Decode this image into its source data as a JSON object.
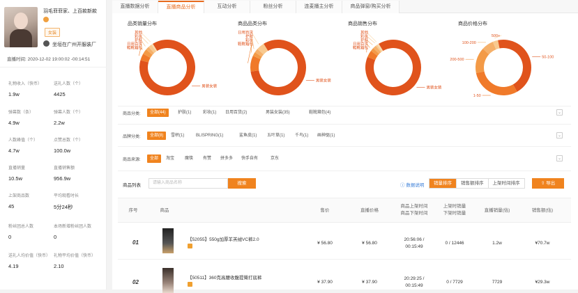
{
  "streamer": {
    "name": "羽毛菲菲家、上百款新款",
    "tag": "女装",
    "shop_name": "坐垣在广州开服装厂",
    "live_time_label": "直播时间:",
    "live_time": "2020-12-02 19:00:02 -00:14:51"
  },
  "stats": [
    {
      "label": "礼物收入（快币）",
      "value": "1.9w"
    },
    {
      "label": "送礼人数（个）",
      "value": "4425"
    },
    {
      "label": "弹幕数（条）",
      "value": "4.9w"
    },
    {
      "label": "弹幕人数（个）",
      "value": "2.2w"
    },
    {
      "label": "人数峰值（个）",
      "value": "4.7w"
    },
    {
      "label": "点赞总数（个）",
      "value": "100.0w"
    },
    {
      "label": "直播销量",
      "value": "10.5w"
    },
    {
      "label": "直播销售额",
      "value": "956.9w"
    },
    {
      "label": "上架商品数",
      "value": "45"
    },
    {
      "label": "平均观看时长",
      "value": "5分24秒"
    },
    {
      "label": "粉丝团总人数",
      "value": "0"
    },
    {
      "label": "本场新增粉丝团人数",
      "value": "0"
    },
    {
      "label": "送礼人均价值（快币）",
      "value": "4.19"
    },
    {
      "label": "礼物平均价值（快币）",
      "value": "2.10"
    }
  ],
  "tabs": [
    "直播数据分析",
    "直播商品分析",
    "互动分析",
    "粉丝分析",
    "连麦播主分析",
    "商品弹窗/购买分析"
  ],
  "active_tab": 1,
  "chart_data": [
    {
      "type": "pie",
      "title": "品类销量分布",
      "labels": [
        "男装女装",
        "鞋靴箱包",
        "日用百货",
        "护肤",
        "彩妆",
        "其他"
      ],
      "values": [
        88,
        4,
        3,
        2,
        2,
        1
      ]
    },
    {
      "type": "pie",
      "title": "商品品类分布",
      "labels": [
        "男装女装",
        "鞋靴箱包",
        "彩妆",
        "护肤",
        "日用百货"
      ],
      "values": [
        35,
        4,
        1,
        1,
        2
      ]
    },
    {
      "type": "pie",
      "title": "商品销售分布",
      "labels": [
        "男装女装",
        "鞋靴箱包",
        "日用百货",
        "护肤",
        "彩妆",
        "其他"
      ],
      "values": [
        90,
        4,
        2,
        2,
        1,
        1
      ]
    },
    {
      "type": "pie",
      "title": "商品价格分布",
      "labels": [
        "50-100",
        "1-50",
        "200-500",
        "100-200",
        "500+"
      ],
      "values": [
        45,
        30,
        15,
        7,
        3
      ]
    }
  ],
  "filters": {
    "category_label": "商品分类:",
    "category": [
      "全部(44)",
      "护肤(1)",
      "彩妆(1)",
      "日用百货(2)",
      "男装女装(35)",
      "鞋靴箱包(4)"
    ],
    "brand_label": "品牌分类:",
    "brand": [
      "全部(8)",
      "雪帜(1)",
      "BLISPRING(1)",
      "鲨鱼皮(1)",
      "五叶草(1)",
      "千鸟(1)",
      "画神驱(1)"
    ],
    "source_label": "商品来源:",
    "source": [
      "全部",
      "淘宝",
      "魔筷",
      "有赞",
      "拼多多",
      "快手自有",
      "京东"
    ]
  },
  "toolbar": {
    "list_label": "商品列表",
    "search_placeholder": "请输入商品名称",
    "search_btn": "搜索",
    "data_link": "数据说明",
    "sorts": [
      "销量排序",
      "销售额排序",
      "上架时间排序"
    ],
    "export": "导出"
  },
  "table": {
    "headers": [
      "序号",
      "商品",
      "售价",
      "直播价格",
      "商品上架时间\n商品下架时间",
      "上架时销量\n下架时销量",
      "直播销量(估)",
      "销售额(估)"
    ],
    "rows": [
      {
        "no": "01",
        "title": "【52055】550g加厚羊羔绒VC裤2.0",
        "price": "¥ 56.80",
        "live_price": "¥ 56.80",
        "time": "20:56:06 /\n00:15:49",
        "sales": "0 / 12446",
        "live_sales": "1.2w",
        "revenue": "¥70.7w"
      },
      {
        "no": "02",
        "title": "【50511】360克高腰收腹提臀打底裤",
        "price": "¥ 37.90",
        "live_price": "¥ 37.90",
        "time": "20:29:25 /\n00:15:49",
        "sales": "0 / 7729",
        "live_sales": "7729",
        "revenue": "¥29.3w"
      }
    ]
  }
}
